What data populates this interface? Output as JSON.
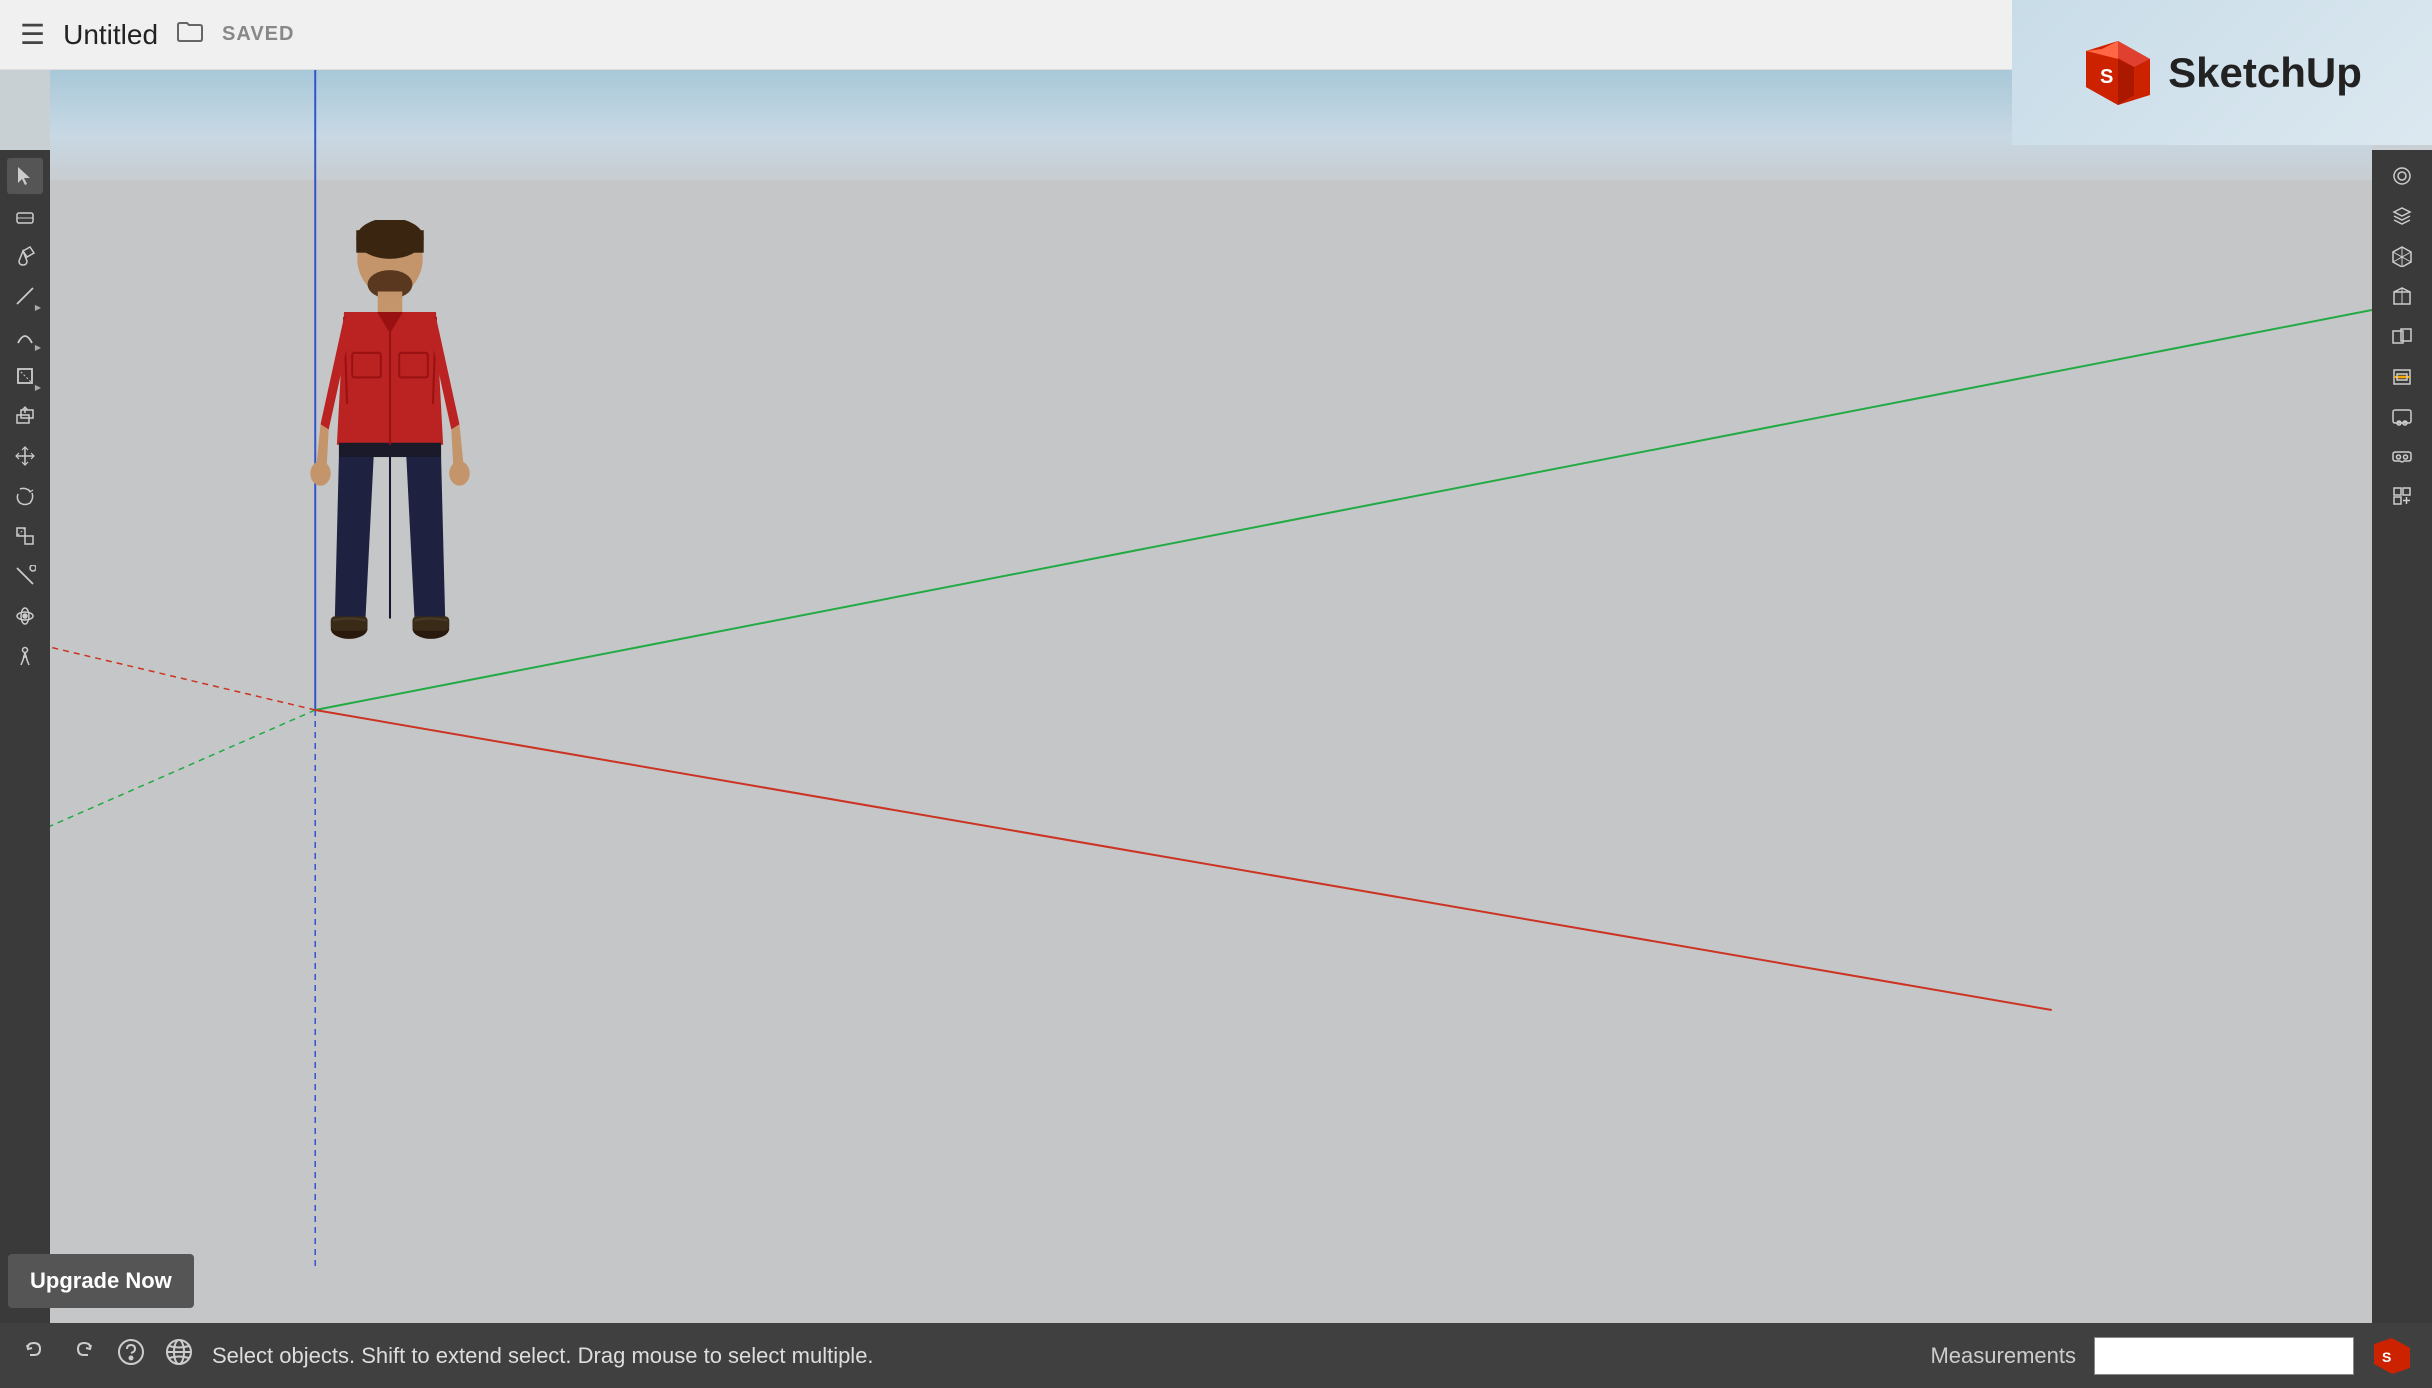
{
  "header": {
    "hamburger": "☰",
    "title": "Untitled",
    "folder_icon": "🗁",
    "saved": "SAVED"
  },
  "logo": {
    "name": "SketchUp"
  },
  "toolbar_left": {
    "tools": [
      {
        "name": "select-tool",
        "label": "Select",
        "has_arrow": false
      },
      {
        "name": "eraser-tool",
        "label": "Eraser",
        "has_arrow": false
      },
      {
        "name": "paint-tool",
        "label": "Paint Bucket",
        "has_arrow": false
      },
      {
        "name": "line-tool",
        "label": "Line",
        "has_arrow": true
      },
      {
        "name": "arc-tool",
        "label": "Arc",
        "has_arrow": true
      },
      {
        "name": "shape-tool",
        "label": "Shape",
        "has_arrow": true
      },
      {
        "name": "push-pull-tool",
        "label": "Push/Pull",
        "has_arrow": false
      },
      {
        "name": "move-tool",
        "label": "Move",
        "has_arrow": false
      },
      {
        "name": "rotate-tool",
        "label": "Rotate",
        "has_arrow": false
      },
      {
        "name": "scale-tool",
        "label": "Scale",
        "has_arrow": false
      },
      {
        "name": "tape-tool",
        "label": "Tape Measure",
        "has_arrow": false
      },
      {
        "name": "orbit-tool",
        "label": "Orbit",
        "has_arrow": false
      },
      {
        "name": "walk-tool",
        "label": "Walk",
        "has_arrow": false
      }
    ]
  },
  "toolbar_right": {
    "tools": [
      {
        "name": "styles-tool",
        "label": "Styles"
      },
      {
        "name": "layers-tool",
        "label": "Layers"
      },
      {
        "name": "components-tool",
        "label": "Components"
      },
      {
        "name": "3dwarehouse-tool",
        "label": "3D Warehouse"
      },
      {
        "name": "solid-tool",
        "label": "Solid Tools"
      },
      {
        "name": "sections-tool",
        "label": "Sections"
      },
      {
        "name": "scenes-tool",
        "label": "Scenes"
      },
      {
        "name": "vr-tool",
        "label": "VR/AR"
      },
      {
        "name": "extension-tool",
        "label": "Extensions"
      }
    ]
  },
  "bottom_bar": {
    "undo_label": "Undo",
    "redo_label": "Redo",
    "help_label": "Help",
    "globe_label": "Globe",
    "status_text": "Select objects. Shift to extend select. Drag mouse to select multiple.",
    "measurements_label": "Measurements",
    "measurements_value": ""
  },
  "upgrade": {
    "button_label": "Upgrade Now"
  },
  "colors": {
    "toolbar_bg": "#3a3a3a",
    "bottom_bg": "#404040",
    "sky_top": "#a8c8d8",
    "sky_bottom": "#c8cdd0",
    "ground": "#c4c6c8",
    "axis_blue": "#3355cc",
    "axis_green": "#22aa44",
    "axis_red": "#cc3322",
    "sketchup_red": "#cc2200"
  }
}
